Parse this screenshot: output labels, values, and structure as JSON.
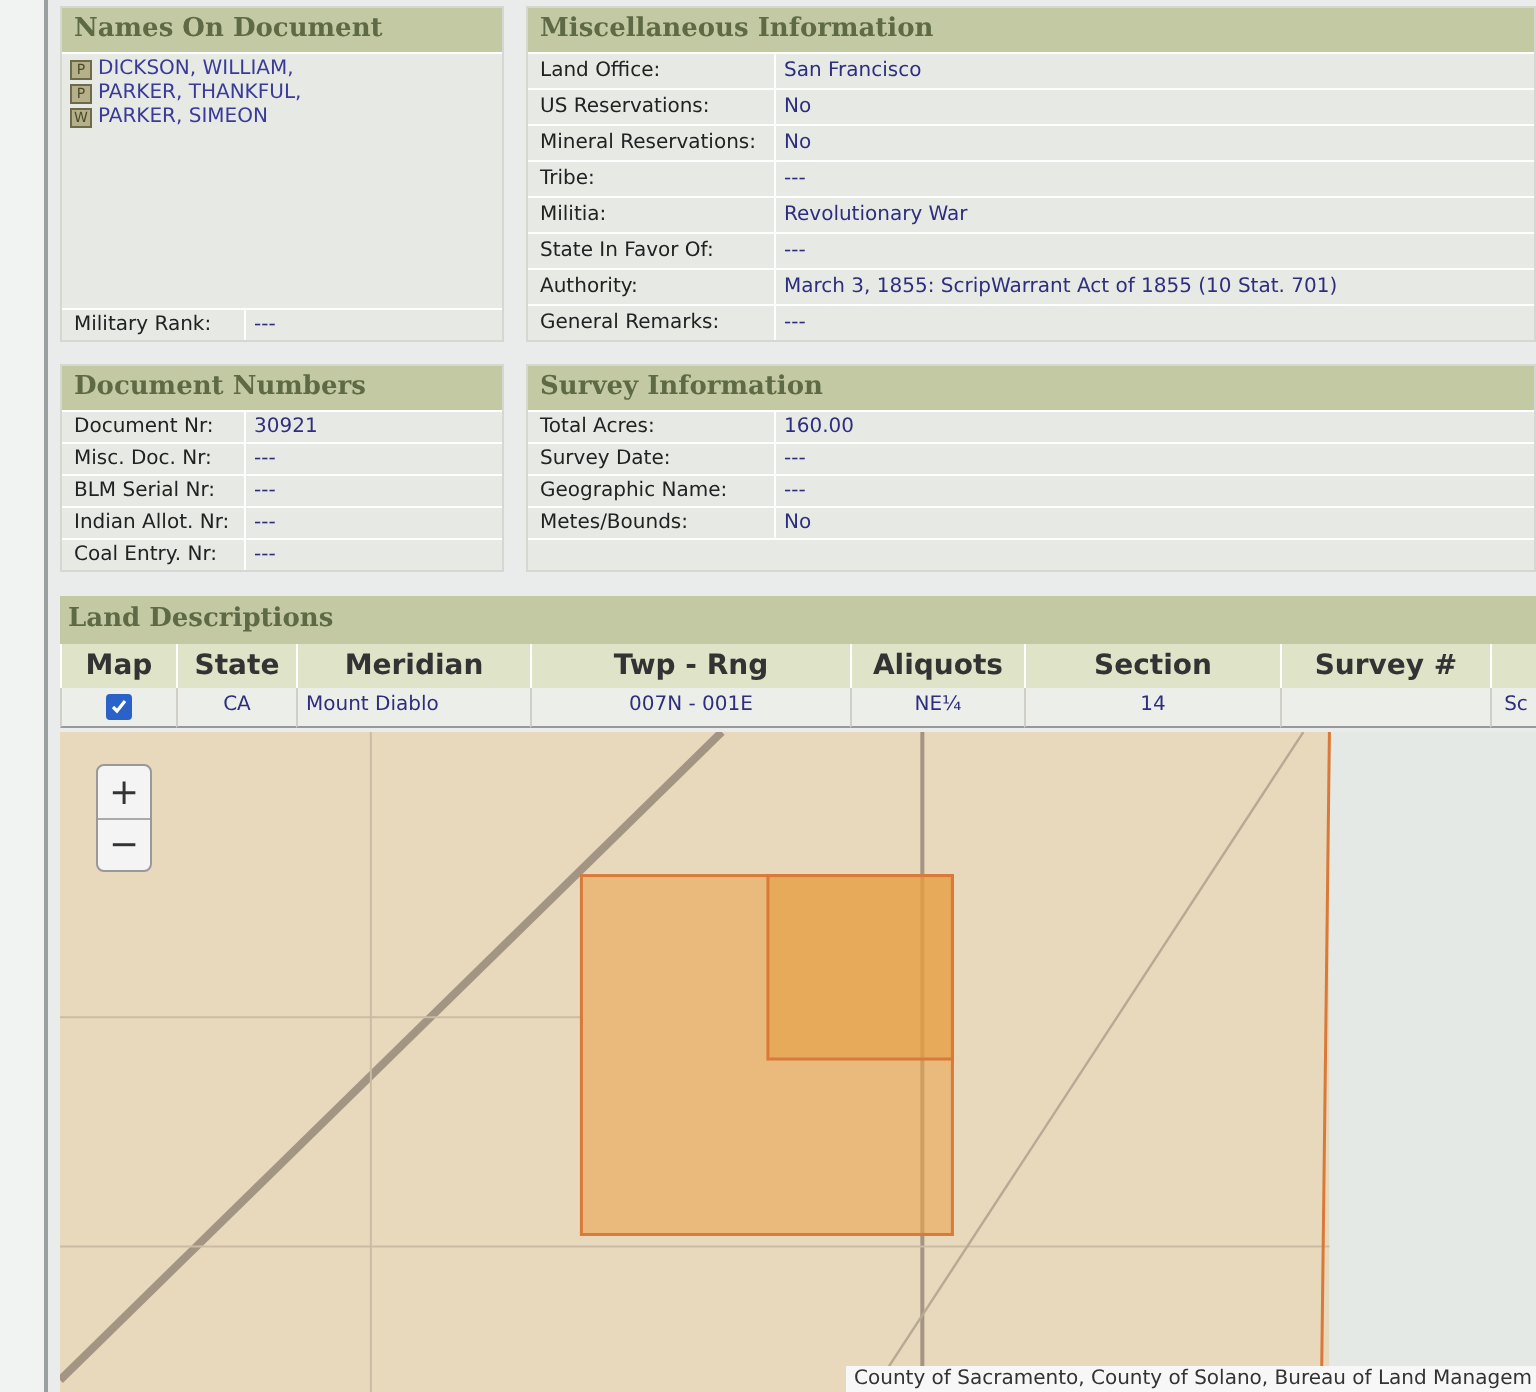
{
  "names_panel": {
    "title": "Names On Document",
    "names": [
      {
        "badge": "P",
        "name": "DICKSON, WILLIAM,"
      },
      {
        "badge": "P",
        "name": "PARKER, THANKFUL,"
      },
      {
        "badge": "W",
        "name": "PARKER, SIMEON"
      }
    ],
    "military_rank": {
      "label": "Military Rank:",
      "value": "---"
    }
  },
  "misc_panel": {
    "title": "Miscellaneous Information",
    "rows": [
      {
        "label": "Land Office:",
        "value": "San Francisco"
      },
      {
        "label": "US Reservations:",
        "value": "No"
      },
      {
        "label": "Mineral Reservations:",
        "value": "No"
      },
      {
        "label": "Tribe:",
        "value": "---"
      },
      {
        "label": "Militia:",
        "value": "Revolutionary War"
      },
      {
        "label": "State In Favor Of:",
        "value": "---"
      },
      {
        "label": "Authority:",
        "value": "March 3, 1855: ScripWarrant Act of 1855 (10 Stat. 701)"
      },
      {
        "label": "General Remarks:",
        "value": "---"
      }
    ]
  },
  "document_numbers": {
    "title": "Document Numbers",
    "rows": [
      {
        "label": "Document Nr:",
        "value": "30921"
      },
      {
        "label": "Misc. Doc. Nr:",
        "value": "---"
      },
      {
        "label": "BLM Serial Nr:",
        "value": "---"
      },
      {
        "label": "Indian Allot. Nr:",
        "value": "---"
      },
      {
        "label": "Coal Entry. Nr:",
        "value": "---"
      }
    ]
  },
  "survey_information": {
    "title": "Survey Information",
    "rows": [
      {
        "label": "Total Acres:",
        "value": "160.00"
      },
      {
        "label": "Survey Date:",
        "value": "---"
      },
      {
        "label": "Geographic Name:",
        "value": "---"
      },
      {
        "label": "Metes/Bounds:",
        "value": "No"
      }
    ]
  },
  "land_descriptions": {
    "title": "Land Descriptions",
    "columns": [
      "Map",
      "State",
      "Meridian",
      "Twp - Rng",
      "Aliquots",
      "Section",
      "Survey #"
    ],
    "rows": [
      {
        "mapped": true,
        "cells": [
          "",
          "CA",
          "Mount Diablo",
          "007N - 001E",
          "NE¼",
          "14",
          "",
          "Sc"
        ]
      }
    ],
    "map": {
      "zoom_in": "+",
      "zoom_out": "−",
      "attribution": "County of Sacramento, County of Solano, Bureau of Land Managem"
    }
  }
}
